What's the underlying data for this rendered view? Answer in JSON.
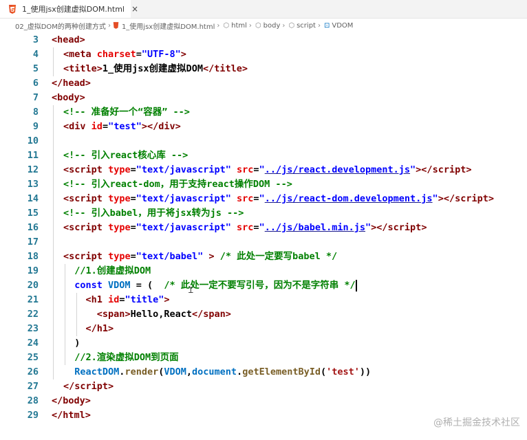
{
  "tab": {
    "title": "1_使用jsx创建虚拟DOM.html",
    "close": "×",
    "icon": "html5-icon"
  },
  "breadcrumb": [
    "02_虚拟DOM的两种创建方式",
    "1_使用jsx创建虚拟DOM.html",
    "html",
    "body",
    "script",
    "VDOM"
  ],
  "watermark": "@稀土掘金技术社区",
  "lines": [
    {
      "n": "3",
      "t": [
        [
          "p",
          "<"
        ],
        [
          "g",
          "head"
        ],
        [
          "p",
          ">"
        ]
      ]
    },
    {
      "n": "4",
      "t": [
        [
          "p",
          "<"
        ],
        [
          "g",
          "meta"
        ],
        [
          "x",
          " "
        ],
        [
          "a",
          "charset"
        ],
        [
          "x",
          "="
        ],
        [
          "s",
          "\"UTF-8\""
        ],
        [
          "p",
          ">"
        ]
      ]
    },
    {
      "n": "5",
      "t": [
        [
          "p",
          "<"
        ],
        [
          "g",
          "title"
        ],
        [
          "p",
          ">"
        ],
        [
          "x",
          "1_使用jsx创建虚拟DOM"
        ],
        [
          "p",
          "</"
        ],
        [
          "g",
          "title"
        ],
        [
          "p",
          ">"
        ]
      ]
    },
    {
      "n": "6",
      "t": [
        [
          "p",
          "</"
        ],
        [
          "g",
          "head"
        ],
        [
          "p",
          ">"
        ]
      ]
    },
    {
      "n": "7",
      "t": [
        [
          "p",
          "<"
        ],
        [
          "g",
          "body"
        ],
        [
          "p",
          ">"
        ]
      ]
    },
    {
      "n": "8",
      "t": [
        [
          "c",
          "<!-- 准备好一个“容器” -->"
        ]
      ]
    },
    {
      "n": "9",
      "t": [
        [
          "p",
          "<"
        ],
        [
          "g",
          "div"
        ],
        [
          "x",
          " "
        ],
        [
          "a",
          "id"
        ],
        [
          "x",
          "="
        ],
        [
          "s",
          "\"test\""
        ],
        [
          "p",
          "></"
        ],
        [
          "g",
          "div"
        ],
        [
          "p",
          ">"
        ]
      ]
    },
    {
      "n": "10",
      "t": []
    },
    {
      "n": "11",
      "t": [
        [
          "c",
          "<!-- 引入react核心库 -->"
        ]
      ]
    },
    {
      "n": "12",
      "t": [
        [
          "p",
          "<"
        ],
        [
          "g",
          "script"
        ],
        [
          "x",
          " "
        ],
        [
          "a",
          "type"
        ],
        [
          "x",
          "="
        ],
        [
          "s",
          "\"text/javascript\""
        ],
        [
          "x",
          " "
        ],
        [
          "a",
          "src"
        ],
        [
          "x",
          "="
        ],
        [
          "s",
          "\""
        ],
        [
          "l",
          "../js/react.development.js"
        ],
        [
          "s",
          "\""
        ],
        [
          "p",
          "></"
        ],
        [
          "g",
          "script"
        ],
        [
          "p",
          ">"
        ]
      ]
    },
    {
      "n": "13",
      "t": [
        [
          "c",
          "<!-- 引入react-dom，用于支持react操作DOM -->"
        ]
      ]
    },
    {
      "n": "14",
      "t": [
        [
          "p",
          "<"
        ],
        [
          "g",
          "script"
        ],
        [
          "x",
          " "
        ],
        [
          "a",
          "type"
        ],
        [
          "x",
          "="
        ],
        [
          "s",
          "\"text/javascript\""
        ],
        [
          "x",
          " "
        ],
        [
          "a",
          "src"
        ],
        [
          "x",
          "="
        ],
        [
          "s",
          "\""
        ],
        [
          "l",
          "../js/react-dom.development.js"
        ],
        [
          "s",
          "\""
        ],
        [
          "p",
          "></"
        ],
        [
          "g",
          "script"
        ],
        [
          "p",
          ">"
        ]
      ]
    },
    {
      "n": "15",
      "t": [
        [
          "c",
          "<!-- 引入babel，用于将jsx转为js -->"
        ]
      ]
    },
    {
      "n": "16",
      "t": [
        [
          "p",
          "<"
        ],
        [
          "g",
          "script"
        ],
        [
          "x",
          " "
        ],
        [
          "a",
          "type"
        ],
        [
          "x",
          "="
        ],
        [
          "s",
          "\"text/javascript\""
        ],
        [
          "x",
          " "
        ],
        [
          "a",
          "src"
        ],
        [
          "x",
          "="
        ],
        [
          "s",
          "\""
        ],
        [
          "l",
          "../js/babel.min.js"
        ],
        [
          "s",
          "\""
        ],
        [
          "p",
          "></"
        ],
        [
          "g",
          "script"
        ],
        [
          "p",
          ">"
        ]
      ]
    },
    {
      "n": "17",
      "t": []
    },
    {
      "n": "18",
      "t": [
        [
          "p",
          "<"
        ],
        [
          "g",
          "script"
        ],
        [
          "x",
          " "
        ],
        [
          "a",
          "type"
        ],
        [
          "x",
          "="
        ],
        [
          "s",
          "\"text/babel\""
        ],
        [
          "x",
          " "
        ],
        [
          "p",
          ">"
        ],
        [
          "x",
          " "
        ],
        [
          "c",
          "/* 此处一定要写babel */"
        ]
      ]
    },
    {
      "n": "19",
      "t": [
        [
          "x",
          "  "
        ],
        [
          "c",
          "//1.创建虚拟DOM"
        ]
      ]
    },
    {
      "n": "20",
      "t": [
        [
          "x",
          "  "
        ],
        [
          "k",
          "const"
        ],
        [
          "x",
          " "
        ],
        [
          "v",
          "VDOM"
        ],
        [
          "x",
          " = (  "
        ],
        [
          "c",
          "/* 此处一定不要写引号，因为不是字符串 */"
        ],
        [
          "cur",
          ""
        ]
      ]
    },
    {
      "n": "21",
      "t": [
        [
          "x",
          "    "
        ],
        [
          "p",
          "<"
        ],
        [
          "g",
          "h1"
        ],
        [
          "x",
          " "
        ],
        [
          "a",
          "id"
        ],
        [
          "x",
          "="
        ],
        [
          "s",
          "\"title\""
        ],
        [
          "p",
          ">"
        ]
      ]
    },
    {
      "n": "22",
      "t": [
        [
          "x",
          "      "
        ],
        [
          "p",
          "<"
        ],
        [
          "g",
          "span"
        ],
        [
          "p",
          ">"
        ],
        [
          "x",
          "Hello,React"
        ],
        [
          "p",
          "</"
        ],
        [
          "g",
          "span"
        ],
        [
          "p",
          ">"
        ]
      ]
    },
    {
      "n": "23",
      "t": [
        [
          "x",
          "    "
        ],
        [
          "p",
          "</"
        ],
        [
          "g",
          "h1"
        ],
        [
          "p",
          ">"
        ]
      ]
    },
    {
      "n": "24",
      "t": [
        [
          "x",
          "  )"
        ]
      ]
    },
    {
      "n": "25",
      "t": [
        [
          "x",
          "  "
        ],
        [
          "c",
          "//2.渲染虚拟DOM到页面"
        ]
      ]
    },
    {
      "n": "26",
      "t": [
        [
          "x",
          "  "
        ],
        [
          "v",
          "ReactDOM"
        ],
        [
          "x",
          "."
        ],
        [
          "f",
          "render"
        ],
        [
          "x",
          "("
        ],
        [
          "v",
          "VDOM"
        ],
        [
          "x",
          ","
        ],
        [
          "v",
          "document"
        ],
        [
          "x",
          "."
        ],
        [
          "f",
          "getElementById"
        ],
        [
          "x",
          "("
        ],
        [
          "r",
          "'test'"
        ],
        [
          "x",
          "))"
        ]
      ]
    },
    {
      "n": "27",
      "t": [
        [
          "p",
          "</"
        ],
        [
          "g",
          "script"
        ],
        [
          "p",
          ">"
        ]
      ]
    },
    {
      "n": "28",
      "t": [
        [
          "p",
          "</"
        ],
        [
          "g",
          "body"
        ],
        [
          "p",
          ">"
        ]
      ]
    },
    {
      "n": "29",
      "t": [
        [
          "p",
          "</"
        ],
        [
          "g",
          "html"
        ],
        [
          "p",
          ">"
        ]
      ]
    }
  ],
  "indents": [
    "0",
    "1",
    "1",
    "0",
    "0",
    "1",
    "1",
    "0",
    "1",
    "1",
    "1",
    "1",
    "1",
    "1",
    "0",
    "1",
    "2",
    "2",
    "3",
    "4",
    "3",
    "2",
    "2",
    "2",
    "1",
    "0",
    "0"
  ]
}
